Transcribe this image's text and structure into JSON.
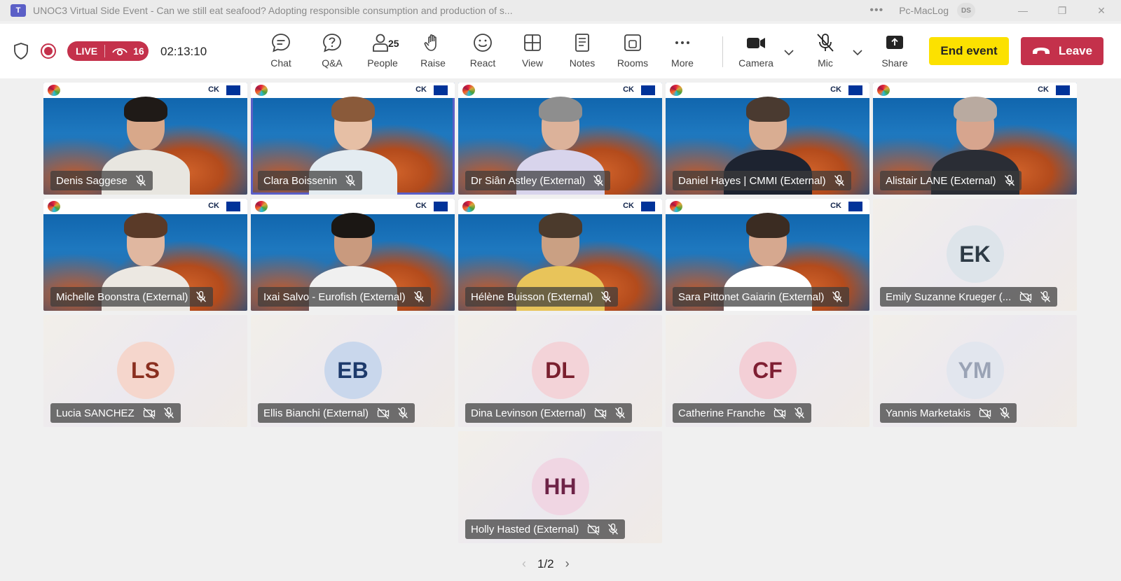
{
  "window": {
    "title": "UNOC3 Virtual Side Event - Can we still eat seafood? Adopting responsible consumption and production of s...",
    "more": "•••",
    "user": "Pc-MacLog",
    "user_initials": "DS",
    "minimize": "—",
    "restore": "❐",
    "close": "✕"
  },
  "status": {
    "live_label": "LIVE",
    "viewer_count": "16",
    "timer": "02:13:10"
  },
  "toolbar": {
    "chat": "Chat",
    "qa": "Q&A",
    "people": "People",
    "people_count": "25",
    "raise": "Raise",
    "react": "React",
    "view": "View",
    "notes": "Notes",
    "rooms": "Rooms",
    "more": "More",
    "camera": "Camera",
    "mic": "Mic",
    "share": "Share",
    "end_event": "End event",
    "leave": "Leave"
  },
  "participants": [
    {
      "name": "Denis Saggese",
      "type": "video"
    },
    {
      "name": "Clara Boissenin",
      "type": "video",
      "active": true
    },
    {
      "name": "Dr Siân Astley (External)",
      "type": "video"
    },
    {
      "name": "Daniel Hayes | CMMI (External)",
      "type": "video"
    },
    {
      "name": "Alistair LANE (External)",
      "type": "video"
    },
    {
      "name": "Michelle Boonstra (External)",
      "type": "video"
    },
    {
      "name": "Ixai Salvo - Eurofish (External)",
      "type": "video"
    },
    {
      "name": "Hélène Buisson (External)",
      "type": "video"
    },
    {
      "name": "Sara Pittonet Gaiarin (External)",
      "type": "video"
    },
    {
      "name": "Emily Suzanne Krueger (...",
      "type": "avatar",
      "initials": "EK",
      "avatar_bg": "#dde4ea",
      "avatar_fg": "#2d3a45"
    },
    {
      "name": "Lucia SANCHEZ",
      "type": "avatar",
      "initials": "LS",
      "avatar_bg": "#f5d6cc",
      "avatar_fg": "#8a2f1f"
    },
    {
      "name": "Ellis Bianchi (External)",
      "type": "avatar",
      "initials": "EB",
      "avatar_bg": "#c9d7ec",
      "avatar_fg": "#1d3a6b"
    },
    {
      "name": "Dina Levinson (External)",
      "type": "avatar",
      "initials": "DL",
      "avatar_bg": "#f3d3d8",
      "avatar_fg": "#7a1f2e"
    },
    {
      "name": "Catherine Franche",
      "type": "avatar",
      "initials": "CF",
      "avatar_bg": "#f3cfd6",
      "avatar_fg": "#7f1f33"
    },
    {
      "name": "Yannis Marketakis",
      "type": "avatar",
      "initials": "YM",
      "avatar_bg": "#e2e6ee",
      "avatar_fg": "#9aa3b5"
    },
    {
      "name": "Holly Hasted (External)",
      "type": "avatar",
      "initials": "HH",
      "avatar_bg": "#f0d6e3",
      "avatar_fg": "#6e2347"
    }
  ],
  "pager": {
    "label": "1/2",
    "prev": "‹",
    "next": "›"
  },
  "colors": {
    "accent": "#5b5fc7",
    "live": "#c4314b",
    "end_event": "#fce100",
    "leave": "#c4314b"
  }
}
